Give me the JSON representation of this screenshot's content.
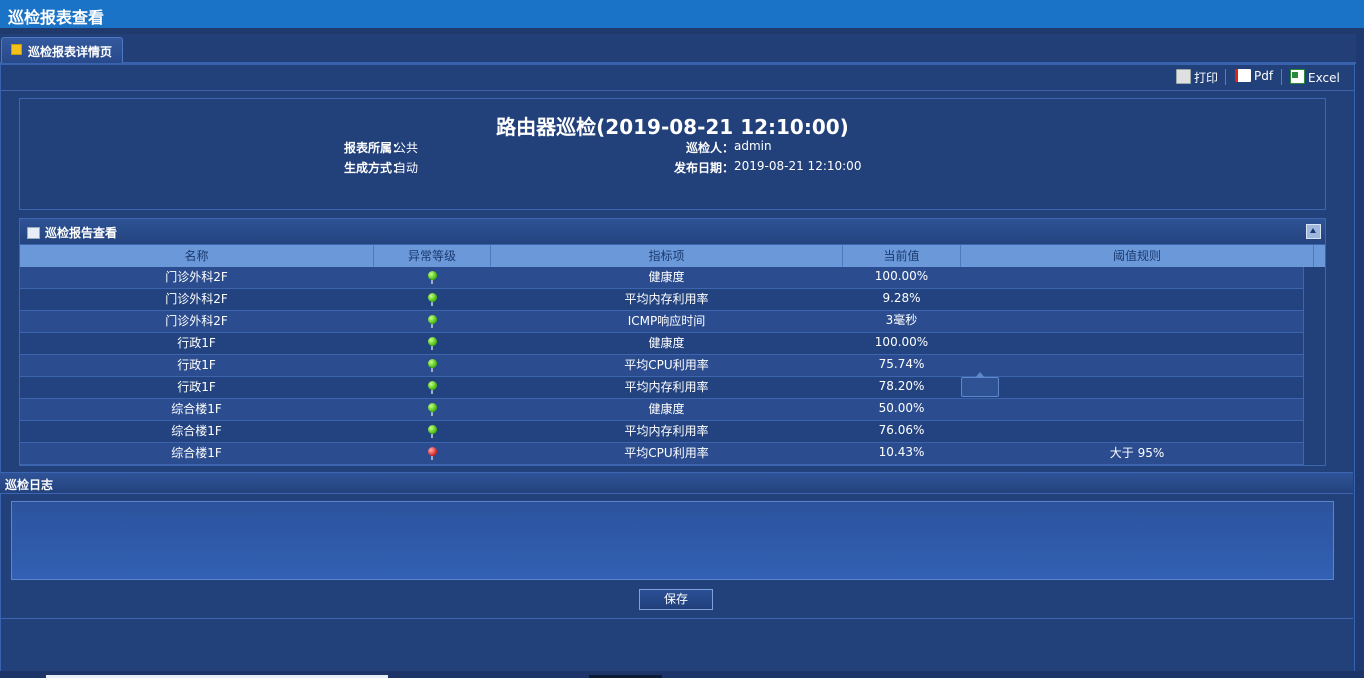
{
  "window": {
    "title": "巡检报表查看"
  },
  "tabs": [
    {
      "label": "巡检报表详情页",
      "active": true
    }
  ],
  "toolbar": {
    "print_label": "打印",
    "pdf_label": "Pdf",
    "excel_label": "Excel"
  },
  "report": {
    "title": "路由器巡检(2019-08-21 12:10:00)",
    "owner_label": "报表所属：",
    "owner_value": "公共",
    "inspector_label": "巡检人：",
    "inspector_value": "admin",
    "gen_label": "生成方式：",
    "gen_value": "自动",
    "date_label": "发布日期：",
    "date_value": "2019-08-21 12:10:00"
  },
  "grid": {
    "title": "巡检报告查看",
    "columns": [
      "名称",
      "异常等级",
      "指标项",
      "当前值",
      "阈值规则"
    ],
    "rows": [
      {
        "name": "门诊外科2F",
        "level": "green",
        "metric": "健康度",
        "value": "100.00%",
        "rule": ""
      },
      {
        "name": "门诊外科2F",
        "level": "green",
        "metric": "平均内存利用率",
        "value": "9.28%",
        "rule": ""
      },
      {
        "name": "门诊外科2F",
        "level": "green",
        "metric": "ICMP响应时间",
        "value": "3毫秒",
        "rule": ""
      },
      {
        "name": "行政1F",
        "level": "green",
        "metric": "健康度",
        "value": "100.00%",
        "rule": ""
      },
      {
        "name": "行政1F",
        "level": "green",
        "metric": "平均CPU利用率",
        "value": "75.74%",
        "rule": ""
      },
      {
        "name": "行政1F",
        "level": "green",
        "metric": "平均内存利用率",
        "value": "78.20%",
        "rule": ""
      },
      {
        "name": "综合楼1F",
        "level": "green",
        "metric": "健康度",
        "value": "50.00%",
        "rule": ""
      },
      {
        "name": "综合楼1F",
        "level": "green",
        "metric": "平均内存利用率",
        "value": "76.06%",
        "rule": ""
      },
      {
        "name": "综合楼1F",
        "level": "red",
        "metric": "平均CPU利用率",
        "value": "10.43%",
        "rule": "大于 95%"
      }
    ]
  },
  "log": {
    "title": "巡检日志",
    "content": ""
  },
  "save_label": "保存",
  "colors": {
    "accent": "#1a73c6",
    "background": "#1f3a72",
    "header_row": "#6b98d8",
    "ok": "#4fbf17",
    "alarm": "#e02c2c"
  }
}
